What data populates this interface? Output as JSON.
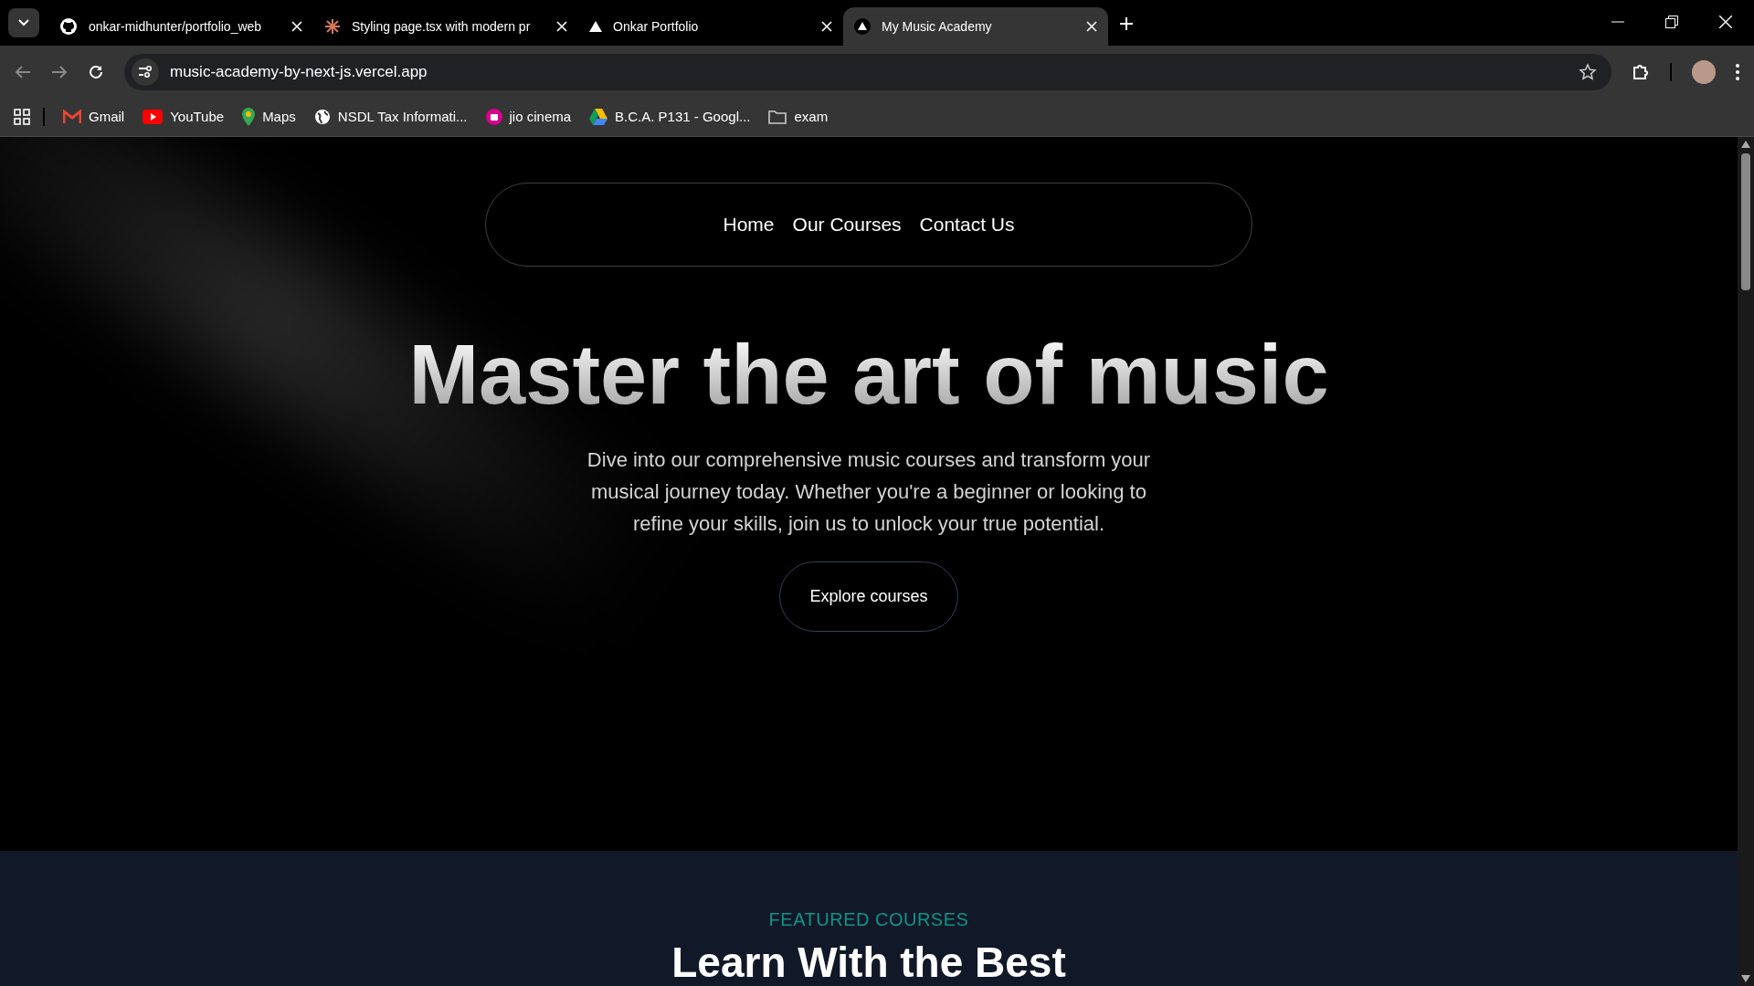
{
  "browser": {
    "tabs": [
      {
        "title": "onkar-midhunter/portfolio_web",
        "selected": false
      },
      {
        "title": "Styling page.tsx with modern pr",
        "selected": false
      },
      {
        "title": "Onkar Portfolio",
        "selected": false
      },
      {
        "title": "My Music Academy",
        "selected": true
      }
    ],
    "address": "music-academy-by-next-js.vercel.app",
    "bookmarks": [
      {
        "label": "Gmail"
      },
      {
        "label": "YouTube"
      },
      {
        "label": "Maps"
      },
      {
        "label": "NSDL Tax Informati..."
      },
      {
        "label": "jio cinema"
      },
      {
        "label": "B.C.A. P131 - Googl..."
      },
      {
        "label": "exam"
      }
    ]
  },
  "nav": {
    "links": [
      "Home",
      "Our Courses",
      "Contact Us"
    ]
  },
  "hero": {
    "title": "Master the art of music",
    "text": "Dive into our comprehensive music courses and transform your musical journey today. Whether you're a beginner or looking to refine your skills, join us to unlock your true potential.",
    "button": "Explore courses"
  },
  "featured": {
    "eyebrow": "FEATURED COURSES",
    "heading": "Learn With the Best"
  }
}
